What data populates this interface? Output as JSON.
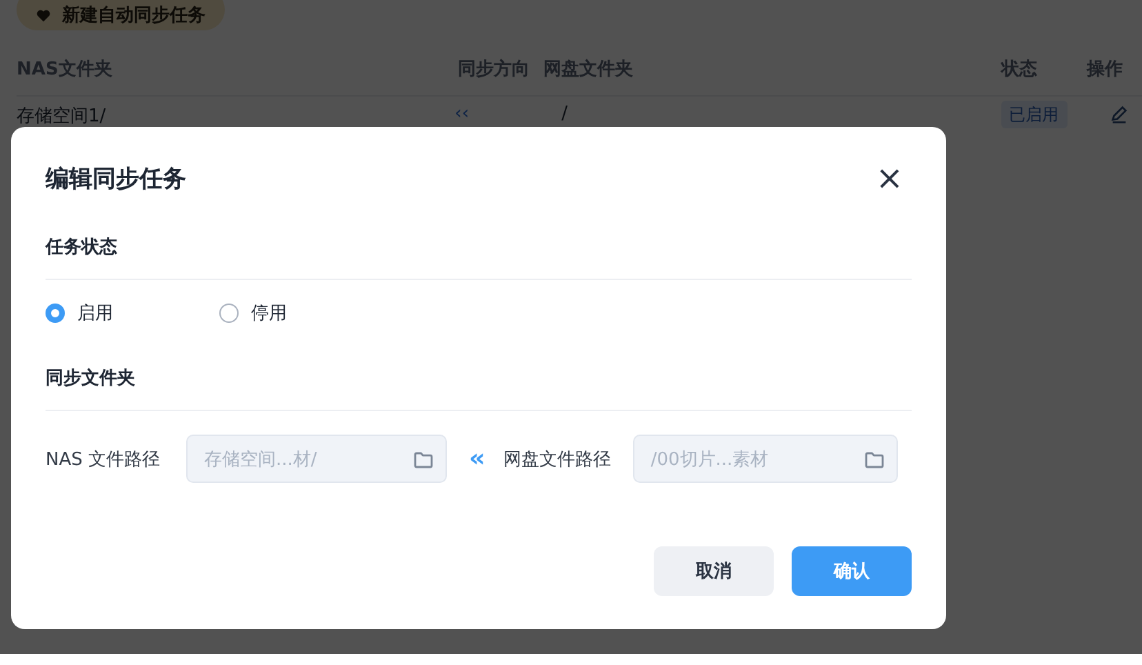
{
  "background": {
    "new_task_button": "新建自动同步任务",
    "table": {
      "columns": [
        "NAS文件夹",
        "同步方向",
        "网盘文件夹",
        "状态",
        "操作"
      ],
      "rows": [
        {
          "nas_folder": "存储空间1/",
          "direction": "‹‹",
          "cloud_folder": "/",
          "status": "已启用"
        }
      ]
    }
  },
  "dialog": {
    "title": "编辑同步任务",
    "close": "×",
    "sections": [
      {
        "title": "任务状态",
        "kind": "radios",
        "options": [
          {
            "label": "启用",
            "selected": true
          },
          {
            "label": "停用",
            "selected": false
          }
        ]
      },
      {
        "title": "同步文件夹",
        "kind": "paths",
        "nas_label": "NAS 文件路径",
        "nas_value": "存储空间...材/",
        "direction": "‹‹",
        "cloud_label": "网盘文件路径",
        "cloud_value": "/00切片...素材"
      }
    ],
    "buttons": [
      {
        "label": "取消",
        "kind": "secondary"
      },
      {
        "label": "确认",
        "kind": "primary"
      }
    ]
  }
}
